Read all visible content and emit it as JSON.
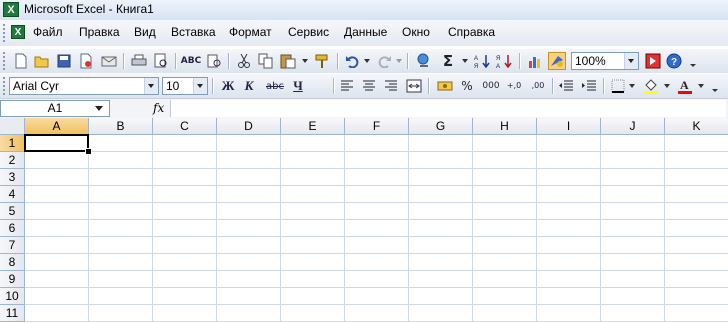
{
  "window": {
    "title": "Microsoft Excel - Книга1",
    "app_icon_glyph": "X"
  },
  "menu": [
    {
      "label": "Файл"
    },
    {
      "label": "Правка"
    },
    {
      "label": "Вид"
    },
    {
      "label": "Вставка"
    },
    {
      "label": "Формат"
    },
    {
      "label": "Сервис"
    },
    {
      "label": "Данные"
    },
    {
      "label": "Окно"
    },
    {
      "label": "Справка"
    }
  ],
  "standard_toolbar": {
    "zoom": "100%",
    "icons": [
      "new-icon",
      "open-icon",
      "save-icon",
      "permission-icon",
      "email-icon",
      "print-icon",
      "print-preview-icon",
      "spelling-icon",
      "research-icon",
      "cut-icon",
      "copy-icon",
      "paste-icon",
      "format-painter-icon",
      "undo-icon",
      "redo-icon",
      "hyperlink-icon",
      "autosum-icon",
      "sort-ascending-icon",
      "sort-descending-icon",
      "chart-wizard-icon",
      "drawing-icon",
      "help-icon"
    ],
    "glyphs": {
      "autosum": "Σ"
    }
  },
  "formatting_toolbar": {
    "font": "Arial Cyr",
    "size": "10",
    "bold": "Ж",
    "italic": "К",
    "strike": "abc",
    "underline": "Ч",
    "percent": "%",
    "thousands": "000",
    "inc_decimal": "+,0",
    "dec_decimal": ",00",
    "colors": {
      "fill": "#ffff00",
      "font": "#ff0000"
    }
  },
  "formula_bar": {
    "name_box": "A1",
    "fx_label": "fx",
    "value": ""
  },
  "sheet": {
    "columns": [
      "A",
      "B",
      "C",
      "D",
      "E",
      "F",
      "G",
      "H",
      "I",
      "J",
      "K"
    ],
    "rows": [
      "1",
      "2",
      "3",
      "4",
      "5",
      "6",
      "7",
      "8",
      "9",
      "10",
      "11"
    ],
    "active_cell": "A1"
  }
}
